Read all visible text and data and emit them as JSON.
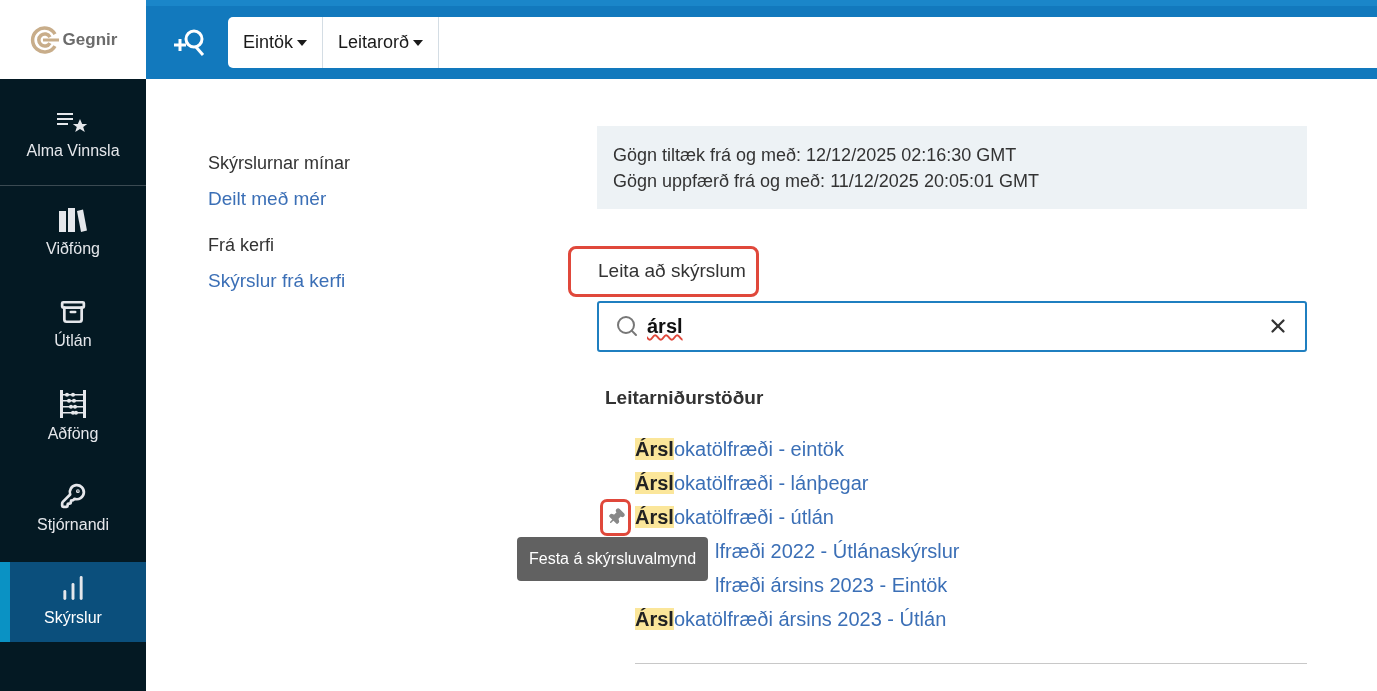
{
  "logo": {
    "text": "Gegnir"
  },
  "toolbar": {
    "tabs": [
      {
        "label": "Eintök"
      },
      {
        "label": "Leitarorð"
      }
    ]
  },
  "sidebar": {
    "items": [
      {
        "label": "Alma Vinnsla",
        "selected": false
      },
      {
        "label": "Viðföng",
        "selected": false
      },
      {
        "label": "Útlán",
        "selected": false
      },
      {
        "label": "Aðföng",
        "selected": false
      },
      {
        "label": "Stjórnandi",
        "selected": false
      },
      {
        "label": "Skýrslur",
        "selected": true
      }
    ]
  },
  "nav": {
    "groups": [
      {
        "title": "Skýrslurnar mínar",
        "link": "Deilt með mér"
      },
      {
        "title": "Frá kerfi",
        "link": "Skýrslur frá kerfi"
      }
    ]
  },
  "info": {
    "lines": [
      "Gögn tiltæk frá og með: 12/12/2025 02:16:30 GMT",
      "Gögn uppfærð frá og með: 11/12/2025 20:05:01 GMT"
    ]
  },
  "search": {
    "label": "Leita að skýrslum",
    "label_highlighted": true,
    "value": "ársl"
  },
  "results": {
    "title": "Leitarniðurstöður",
    "items": [
      {
        "match": "Ársl",
        "rest": "okatölfræði - eintök",
        "pin_shown": false
      },
      {
        "match": "Ársl",
        "rest": "okatölfræði - lánþegar",
        "pin_shown": false
      },
      {
        "match": "Ársl",
        "rest": "okatölfræði - útlán",
        "pin_shown": true,
        "pin_highlighted": true,
        "tooltip": "Festa á skýrsluvalmynd"
      },
      {
        "kind": "covered",
        "rest": "lfræði 2022 - Útlánaskýrslur",
        "pin_shown": false
      },
      {
        "kind": "covered",
        "rest": "lfræði ársins 2023 - Eintök",
        "pin_shown": false
      },
      {
        "match": "Ársl",
        "rest": "okatölfræði ársins 2023 - Útlán",
        "pin_shown": false
      }
    ]
  }
}
